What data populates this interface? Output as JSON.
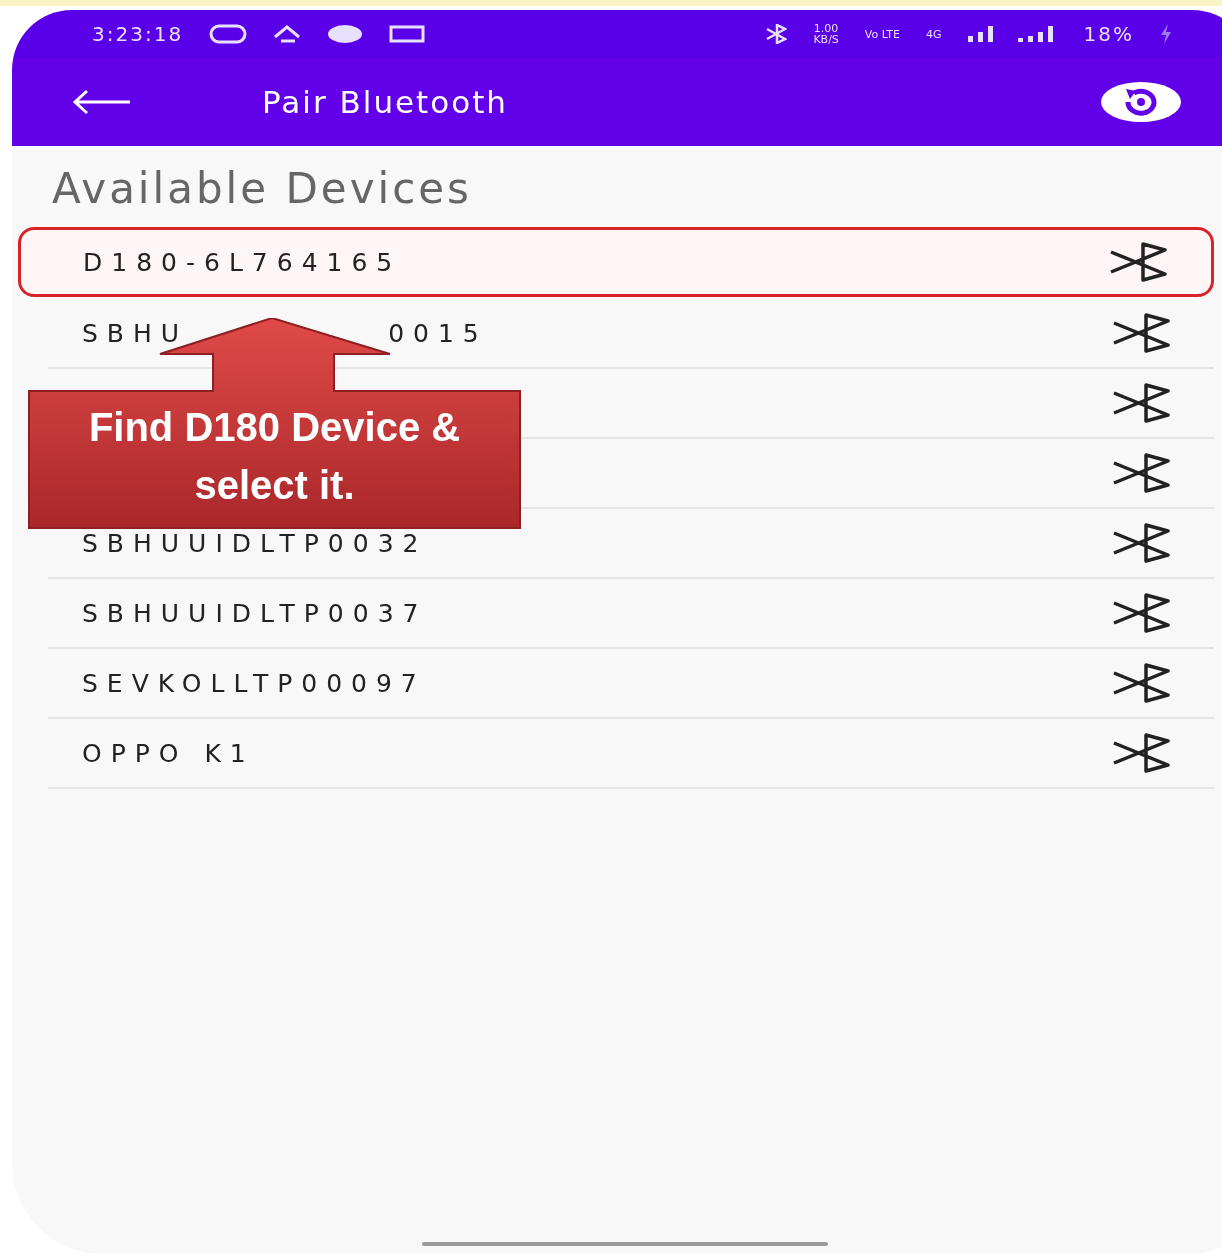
{
  "status_bar": {
    "time": "3:23:18",
    "speed_value": "1.00",
    "speed_unit": "KB/S",
    "volte": "Vo LTE",
    "network": "4G",
    "battery": "18%"
  },
  "app_bar": {
    "title": "Pair Bluetooth"
  },
  "section_title": "Available Devices",
  "devices": [
    {
      "name": "D180-6L764165",
      "selected": true
    },
    {
      "name_parts": [
        "SBHU",
        "0015"
      ],
      "selected": false
    },
    {
      "selected": false
    },
    {
      "selected": false
    },
    {
      "name": "SBHUUIDLTP0032",
      "selected": false
    },
    {
      "name": "SBHUUIDLTP0037",
      "selected": false
    },
    {
      "name": "SEVKOLLTP00097",
      "selected": false
    },
    {
      "name": "OPPO K1",
      "selected": false
    }
  ],
  "callout": {
    "text": "Find D180 Device & select it."
  }
}
